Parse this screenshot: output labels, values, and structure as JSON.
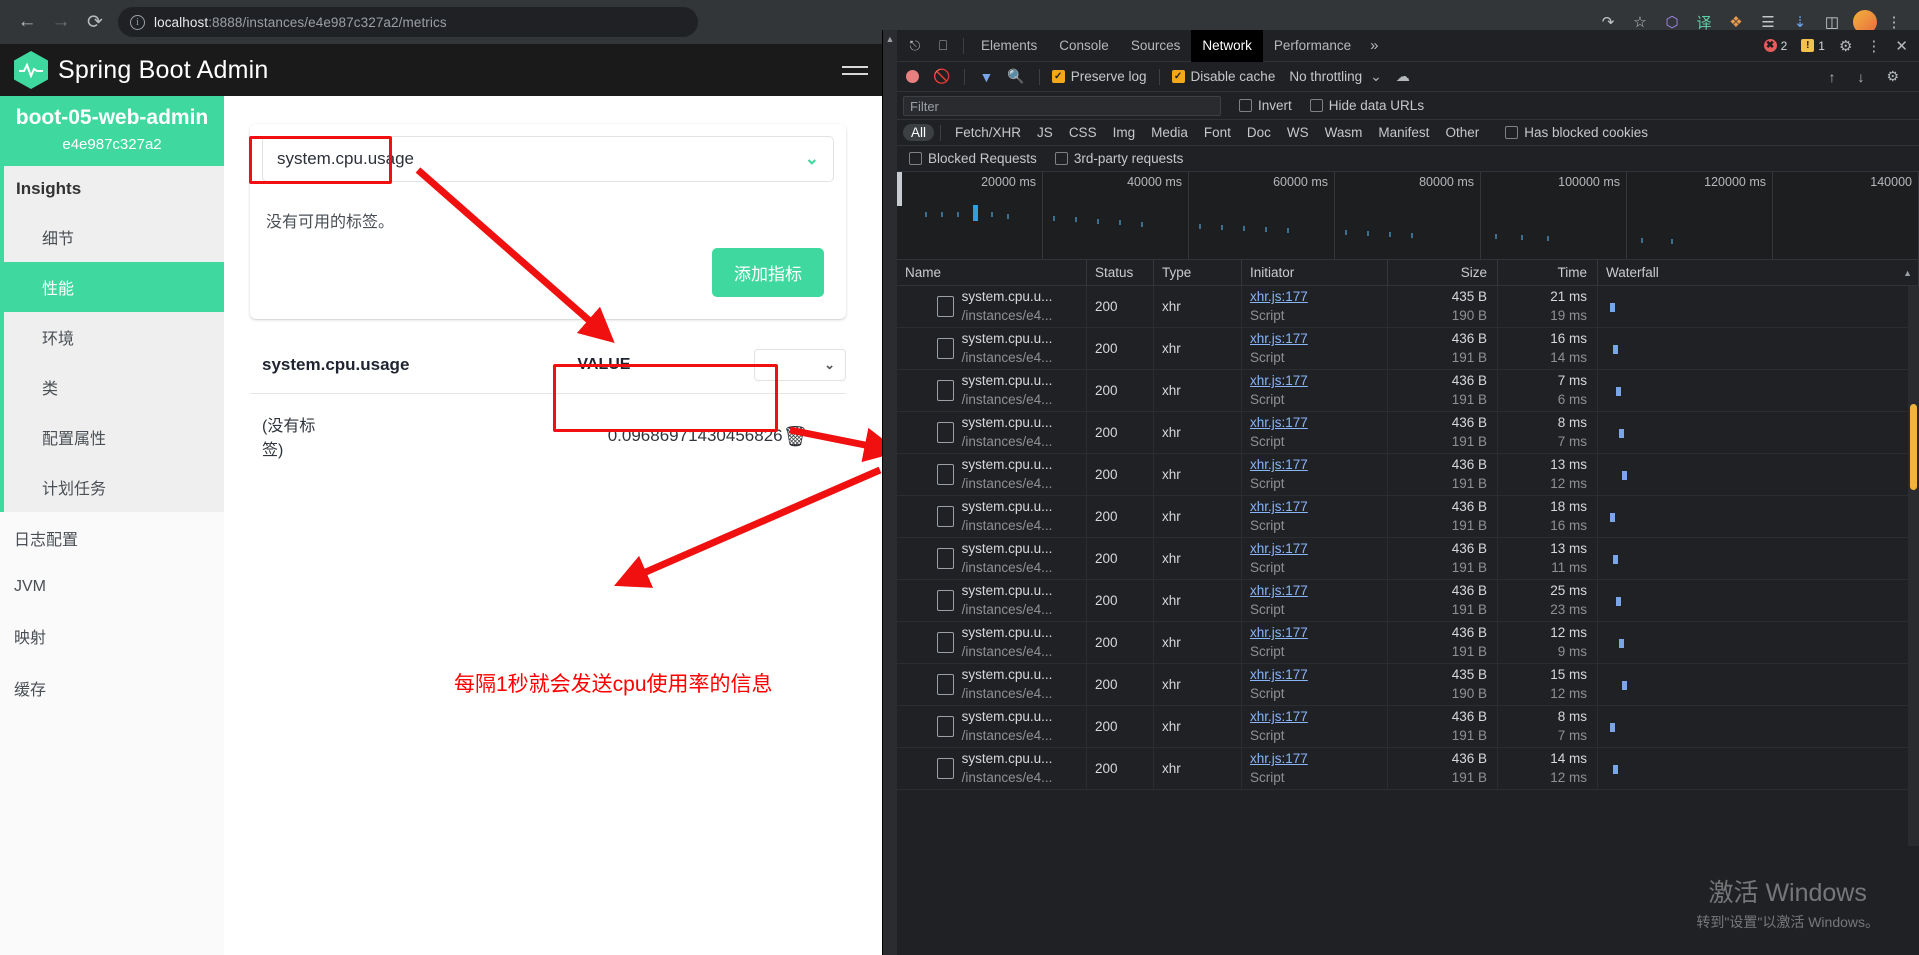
{
  "browser": {
    "back_icon": "back-arrow",
    "forward_icon": "forward-arrow",
    "reload_icon": "reload",
    "site_info_icon": "info-circle",
    "url_host": "localhost",
    "url_rest": ":8888/instances/e4e987c327a2/metrics",
    "icons": [
      "share-icon",
      "bookmark-star-icon",
      "shield-icon",
      "translate-icon",
      "extensions-icon",
      "reading-list-icon",
      "downloads-icon",
      "sidepanel-icon",
      "profile-avatar"
    ]
  },
  "app": {
    "title": "Spring Boot Admin",
    "logo_icon": "heartbeat-hexagon-logo",
    "menu_icon": "hamburger-menu"
  },
  "sidebar": {
    "instance_name": "boot-05-web-admin",
    "instance_id": "e4e987c327a2",
    "group_label": "Insights",
    "group_items": [
      {
        "label": "细节",
        "active": false
      },
      {
        "label": "性能",
        "active": true
      },
      {
        "label": "环境",
        "active": false
      },
      {
        "label": "类",
        "active": false
      },
      {
        "label": "配置属性",
        "active": false
      },
      {
        "label": "计划任务",
        "active": false
      }
    ],
    "root_items": [
      {
        "label": "日志配置"
      },
      {
        "label": "JVM"
      },
      {
        "label": "映射"
      },
      {
        "label": "缓存"
      }
    ]
  },
  "main": {
    "metric_select_value": "system.cpu.usage",
    "metric_select_chevron": "chevron-down-icon",
    "no_tags_text": "没有可用的标签。",
    "add_metric_button": "添加指标",
    "metric_title": "system.cpu.usage",
    "value_column_label": "VALUE",
    "unit_select_value": "-",
    "unit_select_chevron": "chevron-down-icon",
    "row_label": "(没有标签)",
    "row_value": "0.09686971430456826",
    "delete_icon": "trash-icon",
    "annotation_note": "每隔1秒就会发送cpu使用率的信息",
    "annotation_color": "#ff0000"
  },
  "devtools": {
    "inspect_icon": "inspect-element-icon",
    "device_icon": "device-toolbar-icon",
    "tabs": [
      {
        "label": "Elements",
        "active": false
      },
      {
        "label": "Console",
        "active": false
      },
      {
        "label": "Sources",
        "active": false
      },
      {
        "label": "Network",
        "active": true
      },
      {
        "label": "Performance",
        "active": false
      }
    ],
    "more_tabs_icon": "chevron-right-icon",
    "error_count": "2",
    "warning_count": "1",
    "gear_icon": "settings-gear-icon",
    "kebab_icon": "more-vertical-icon",
    "close_icon": "close-x-icon",
    "toolbar": {
      "record_icon": "record-stop-icon",
      "clear_icon": "clear-no-entry-icon",
      "filter_icon": "funnel-filter-icon",
      "search_icon": "magnifier-search-icon",
      "preserve_log": "Preserve log",
      "preserve_log_checked": true,
      "disable_cache": "Disable cache",
      "disable_cache_checked": true,
      "throttling": "No throttling",
      "throttle_chevron": "chevron-down-icon",
      "wifi_icon": "network-conditions-icon",
      "import_icon": "import-har-up-arrow-icon",
      "export_icon": "export-har-down-arrow-icon",
      "settings_icon": "network-settings-gear-icon"
    },
    "filter": {
      "placeholder": "Filter",
      "invert": "Invert",
      "invert_checked": false,
      "hide_data_urls": "Hide data URLs",
      "hide_data_urls_checked": false
    },
    "type_filters": [
      {
        "label": "All",
        "selected": true
      },
      {
        "label": "Fetch/XHR",
        "selected": false
      },
      {
        "label": "JS",
        "selected": false
      },
      {
        "label": "CSS",
        "selected": false
      },
      {
        "label": "Img",
        "selected": false
      },
      {
        "label": "Media",
        "selected": false
      },
      {
        "label": "Font",
        "selected": false
      },
      {
        "label": "Doc",
        "selected": false
      },
      {
        "label": "WS",
        "selected": false
      },
      {
        "label": "Wasm",
        "selected": false
      },
      {
        "label": "Manifest",
        "selected": false
      },
      {
        "label": "Other",
        "selected": false
      }
    ],
    "has_blocked_cookies": "Has blocked cookies",
    "has_blocked_cookies_checked": false,
    "blocked_requests": "Blocked Requests",
    "blocked_requests_checked": false,
    "third_party_requests": "3rd-party requests",
    "third_party_requests_checked": false,
    "overview_ticks": [
      "20000 ms",
      "40000 ms",
      "60000 ms",
      "80000 ms",
      "100000 ms",
      "120000 ms",
      "140000"
    ],
    "columns": [
      "Name",
      "Status",
      "Type",
      "Initiator",
      "Size",
      "Time",
      "Waterfall"
    ],
    "waterfall_sort_icon": "sort-caret-up-icon",
    "rows": [
      {
        "name1": "system.cpu.u...",
        "name2": "/instances/e4...",
        "status": "200",
        "type": "xhr",
        "initiator1": "xhr.js:177",
        "initiator2": "Script",
        "size1": "435 B",
        "size2": "190 B",
        "time1": "21 ms",
        "time2": "19 ms",
        "highlighted": false
      },
      {
        "name1": "system.cpu.u...",
        "name2": "/instances/e4...",
        "status": "200",
        "type": "xhr",
        "initiator1": "xhr.js:177",
        "initiator2": "Script",
        "size1": "436 B",
        "size2": "191 B",
        "time1": "16 ms",
        "time2": "14 ms",
        "highlighted": false
      },
      {
        "name1": "system.cpu.u...",
        "name2": "/instances/e4...",
        "status": "200",
        "type": "xhr",
        "initiator1": "xhr.js:177",
        "initiator2": "Script",
        "size1": "436 B",
        "size2": "191 B",
        "time1": "7 ms",
        "time2": "6 ms",
        "highlighted": false
      },
      {
        "name1": "system.cpu.u...",
        "name2": "/instances/e4...",
        "status": "200",
        "type": "xhr",
        "initiator1": "xhr.js:177",
        "initiator2": "Script",
        "size1": "436 B",
        "size2": "191 B",
        "time1": "8 ms",
        "time2": "7 ms",
        "highlighted": true
      },
      {
        "name1": "system.cpu.u...",
        "name2": "/instances/e4...",
        "status": "200",
        "type": "xhr",
        "initiator1": "xhr.js:177",
        "initiator2": "Script",
        "size1": "436 B",
        "size2": "191 B",
        "time1": "13 ms",
        "time2": "12 ms",
        "highlighted": false
      },
      {
        "name1": "system.cpu.u...",
        "name2": "/instances/e4...",
        "status": "200",
        "type": "xhr",
        "initiator1": "xhr.js:177",
        "initiator2": "Script",
        "size1": "436 B",
        "size2": "191 B",
        "time1": "18 ms",
        "time2": "16 ms",
        "highlighted": false
      },
      {
        "name1": "system.cpu.u...",
        "name2": "/instances/e4...",
        "status": "200",
        "type": "xhr",
        "initiator1": "xhr.js:177",
        "initiator2": "Script",
        "size1": "436 B",
        "size2": "191 B",
        "time1": "13 ms",
        "time2": "11 ms",
        "highlighted": false
      },
      {
        "name1": "system.cpu.u...",
        "name2": "/instances/e4...",
        "status": "200",
        "type": "xhr",
        "initiator1": "xhr.js:177",
        "initiator2": "Script",
        "size1": "436 B",
        "size2": "191 B",
        "time1": "25 ms",
        "time2": "23 ms",
        "highlighted": false
      },
      {
        "name1": "system.cpu.u...",
        "name2": "/instances/e4...",
        "status": "200",
        "type": "xhr",
        "initiator1": "xhr.js:177",
        "initiator2": "Script",
        "size1": "436 B",
        "size2": "191 B",
        "time1": "12 ms",
        "time2": "9 ms",
        "highlighted": false
      },
      {
        "name1": "system.cpu.u...",
        "name2": "/instances/e4...",
        "status": "200",
        "type": "xhr",
        "initiator1": "xhr.js:177",
        "initiator2": "Script",
        "size1": "435 B",
        "size2": "190 B",
        "time1": "15 ms",
        "time2": "12 ms",
        "highlighted": false
      },
      {
        "name1": "system.cpu.u...",
        "name2": "/instances/e4...",
        "status": "200",
        "type": "xhr",
        "initiator1": "xhr.js:177",
        "initiator2": "Script",
        "size1": "436 B",
        "size2": "191 B",
        "time1": "8 ms",
        "time2": "7 ms",
        "highlighted": false
      },
      {
        "name1": "system.cpu.u...",
        "name2": "/instances/e4...",
        "status": "200",
        "type": "xhr",
        "initiator1": "xhr.js:177",
        "initiator2": "Script",
        "size1": "436 B",
        "size2": "191 B",
        "time1": "14 ms",
        "time2": "12 ms",
        "highlighted": false
      }
    ]
  },
  "watermark": {
    "line1": "激活 Windows",
    "line2": "转到\"设置\"以激活 Windows。"
  }
}
